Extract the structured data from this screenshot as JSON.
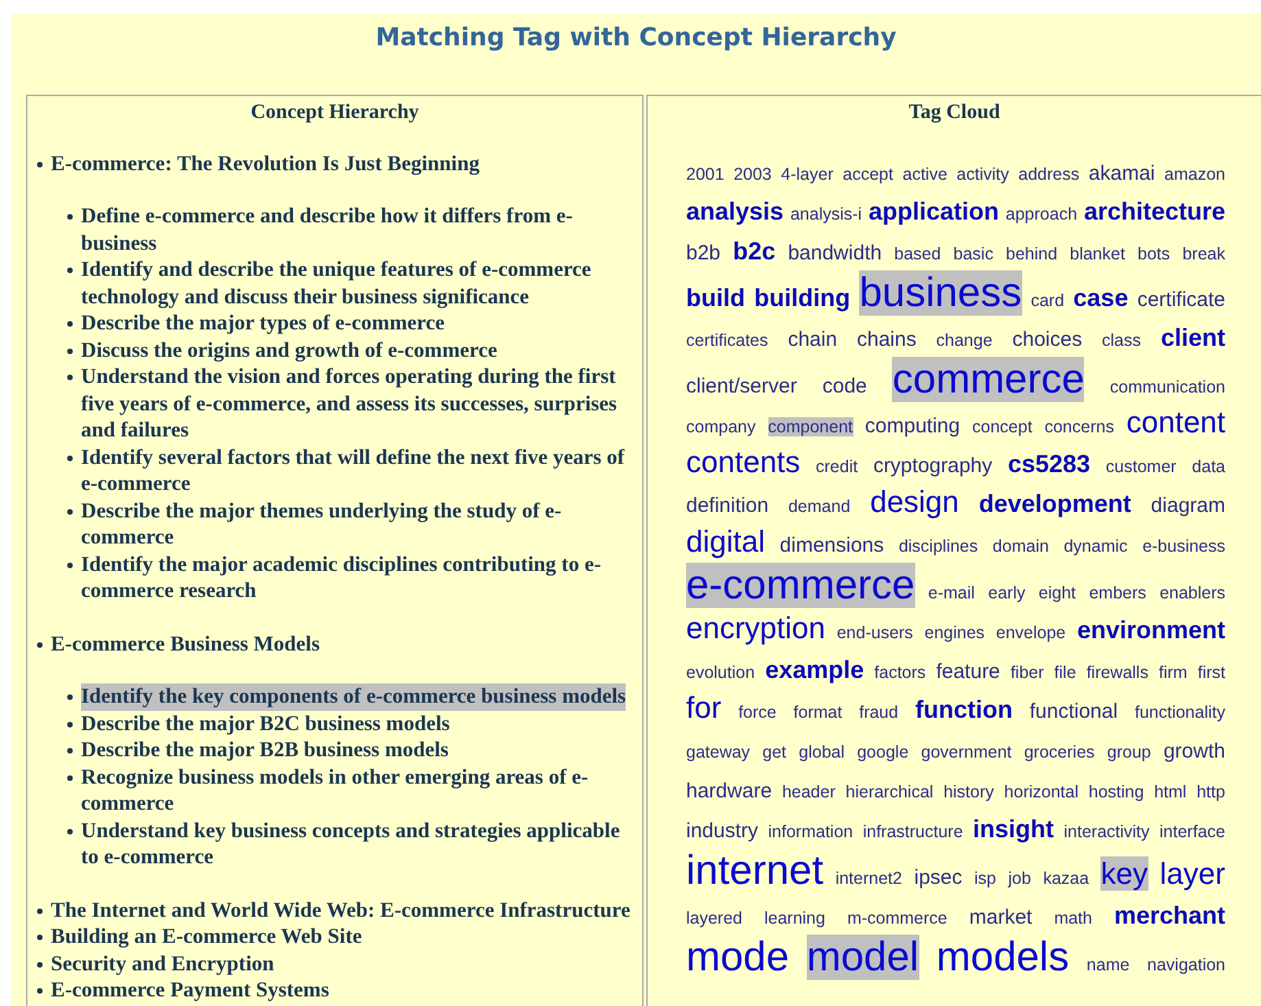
{
  "page_title": "Matching Tag with Concept Hierarchy",
  "concept_hierarchy": {
    "title": "Concept Hierarchy",
    "items": [
      {
        "label": "E-commerce: The Revolution Is Just Beginning",
        "children": [
          {
            "label": "Define e-commerce and describe how it differs from e-business",
            "highlighted": false
          },
          {
            "label": "Identify and describe the unique features of e-commerce technology and discuss their business significance",
            "highlighted": false
          },
          {
            "label": "Describe the major types of e-commerce",
            "highlighted": false
          },
          {
            "label": "Discuss the origins and growth of e-commerce",
            "highlighted": false
          },
          {
            "label": "Understand the vision and forces operating during the first five years of e-commerce, and assess its successes, surprises and failures",
            "highlighted": false
          },
          {
            "label": "Identify several factors that will define the next five years of e-commerce",
            "highlighted": false
          },
          {
            "label": "Describe the major themes underlying the study of e-commerce",
            "highlighted": false
          },
          {
            "label": "Identify the major academic disciplines contributing to e-commerce research",
            "highlighted": false
          }
        ]
      },
      {
        "label": "E-commerce Business Models",
        "children": [
          {
            "label": "Identify the key components of e-commerce business models",
            "highlighted": true
          },
          {
            "label": "Describe the major B2C business models",
            "highlighted": false
          },
          {
            "label": "Describe the major B2B business models",
            "highlighted": false
          },
          {
            "label": "Recognize business models in other emerging areas of e-commerce",
            "highlighted": false
          },
          {
            "label": "Understand key business concepts and strategies applicable to e-commerce",
            "highlighted": false
          }
        ]
      },
      {
        "label": "The Internet and World Wide Web: E-commerce Infrastructure"
      },
      {
        "label": "Building an E-commerce Web Site"
      },
      {
        "label": "Security and Encryption"
      },
      {
        "label": "E-commerce Payment Systems"
      }
    ]
  },
  "tag_cloud": {
    "title": "Tag Cloud",
    "tags": [
      {
        "label": "2001",
        "kind": "tiny",
        "highlighted": false
      },
      {
        "label": "2003",
        "kind": "tiny",
        "highlighted": false
      },
      {
        "label": "4-layer",
        "kind": "tiny",
        "highlighted": false
      },
      {
        "label": "accept",
        "kind": "tiny",
        "highlighted": false
      },
      {
        "label": "active",
        "kind": "tiny",
        "highlighted": false
      },
      {
        "label": "activity",
        "kind": "tiny",
        "highlighted": false
      },
      {
        "label": "address",
        "kind": "tiny",
        "highlighted": false
      },
      {
        "label": "akamai",
        "kind": "small",
        "highlighted": false
      },
      {
        "label": "amazon",
        "kind": "tiny",
        "highlighted": false
      },
      {
        "label": "analysis",
        "kind": "medium",
        "highlighted": false
      },
      {
        "label": "analysis-i",
        "kind": "tiny",
        "highlighted": false
      },
      {
        "label": "application",
        "kind": "medium",
        "highlighted": false
      },
      {
        "label": "approach",
        "kind": "tiny",
        "highlighted": false
      },
      {
        "label": "architecture",
        "kind": "medium",
        "highlighted": false
      },
      {
        "label": "b2b",
        "kind": "small",
        "highlighted": false
      },
      {
        "label": "b2c",
        "kind": "medium",
        "highlighted": false
      },
      {
        "label": "bandwidth",
        "kind": "small",
        "highlighted": false
      },
      {
        "label": "based",
        "kind": "tiny",
        "highlighted": false
      },
      {
        "label": "basic",
        "kind": "tiny",
        "highlighted": false
      },
      {
        "label": "behind",
        "kind": "tiny",
        "highlighted": false
      },
      {
        "label": "blanket",
        "kind": "tiny",
        "highlighted": false
      },
      {
        "label": "bots",
        "kind": "tiny",
        "highlighted": false
      },
      {
        "label": "break",
        "kind": "tiny",
        "highlighted": false
      },
      {
        "label": "build",
        "kind": "medium",
        "highlighted": false
      },
      {
        "label": "building",
        "kind": "medium",
        "highlighted": false
      },
      {
        "label": "business",
        "kind": "huge",
        "highlighted": true
      },
      {
        "label": "card",
        "kind": "tiny",
        "highlighted": false
      },
      {
        "label": "case",
        "kind": "medium",
        "highlighted": false
      },
      {
        "label": "certificate",
        "kind": "small",
        "highlighted": false
      },
      {
        "label": "certificates",
        "kind": "tiny",
        "highlighted": false
      },
      {
        "label": "chain",
        "kind": "small",
        "highlighted": false
      },
      {
        "label": "chains",
        "kind": "small",
        "highlighted": false
      },
      {
        "label": "change",
        "kind": "tiny",
        "highlighted": false
      },
      {
        "label": "choices",
        "kind": "small",
        "highlighted": false
      },
      {
        "label": "class",
        "kind": "tiny",
        "highlighted": false
      },
      {
        "label": "client",
        "kind": "medium",
        "highlighted": false
      },
      {
        "label": "client/server",
        "kind": "small",
        "highlighted": false
      },
      {
        "label": "code",
        "kind": "small",
        "highlighted": false
      },
      {
        "label": "commerce",
        "kind": "huge",
        "highlighted": true
      },
      {
        "label": "communication",
        "kind": "tiny",
        "highlighted": false
      },
      {
        "label": "company",
        "kind": "tiny",
        "highlighted": false
      },
      {
        "label": "component",
        "kind": "tiny",
        "highlighted": true
      },
      {
        "label": "computing",
        "kind": "small",
        "highlighted": false
      },
      {
        "label": "concept",
        "kind": "tiny",
        "highlighted": false
      },
      {
        "label": "concerns",
        "kind": "tiny",
        "highlighted": false
      },
      {
        "label": "content",
        "kind": "large",
        "highlighted": false
      },
      {
        "label": "contents",
        "kind": "large",
        "highlighted": false
      },
      {
        "label": "credit",
        "kind": "tiny",
        "highlighted": false
      },
      {
        "label": "cryptography",
        "kind": "small",
        "highlighted": false
      },
      {
        "label": "cs5283",
        "kind": "medium",
        "highlighted": false
      },
      {
        "label": "customer",
        "kind": "tiny",
        "highlighted": false
      },
      {
        "label": "data",
        "kind": "tiny",
        "highlighted": false
      },
      {
        "label": "definition",
        "kind": "small",
        "highlighted": false
      },
      {
        "label": "demand",
        "kind": "tiny",
        "highlighted": false
      },
      {
        "label": "design",
        "kind": "large",
        "highlighted": false
      },
      {
        "label": "development",
        "kind": "medium",
        "highlighted": false
      },
      {
        "label": "diagram",
        "kind": "small",
        "highlighted": false
      },
      {
        "label": "digital",
        "kind": "large",
        "highlighted": false
      },
      {
        "label": "dimensions",
        "kind": "small",
        "highlighted": false
      },
      {
        "label": "disciplines",
        "kind": "tiny",
        "highlighted": false
      },
      {
        "label": "domain",
        "kind": "tiny",
        "highlighted": false
      },
      {
        "label": "dynamic",
        "kind": "tiny",
        "highlighted": false
      },
      {
        "label": "e-business",
        "kind": "tiny",
        "highlighted": false
      },
      {
        "label": "e-commerce",
        "kind": "huge",
        "highlighted": true
      },
      {
        "label": "e-mail",
        "kind": "tiny",
        "highlighted": false
      },
      {
        "label": "early",
        "kind": "tiny",
        "highlighted": false
      },
      {
        "label": "eight",
        "kind": "tiny",
        "highlighted": false
      },
      {
        "label": "embers",
        "kind": "tiny",
        "highlighted": false
      },
      {
        "label": "enablers",
        "kind": "tiny",
        "highlighted": false
      },
      {
        "label": "encryption",
        "kind": "large",
        "highlighted": false
      },
      {
        "label": "end-users",
        "kind": "tiny",
        "highlighted": false
      },
      {
        "label": "engines",
        "kind": "tiny",
        "highlighted": false
      },
      {
        "label": "envelope",
        "kind": "tiny",
        "highlighted": false
      },
      {
        "label": "environment",
        "kind": "medium",
        "highlighted": false
      },
      {
        "label": "evolution",
        "kind": "tiny",
        "highlighted": false
      },
      {
        "label": "example",
        "kind": "medium",
        "highlighted": false
      },
      {
        "label": "factors",
        "kind": "tiny",
        "highlighted": false
      },
      {
        "label": "feature",
        "kind": "small",
        "highlighted": false
      },
      {
        "label": "fiber",
        "kind": "tiny",
        "highlighted": false
      },
      {
        "label": "file",
        "kind": "tiny",
        "highlighted": false
      },
      {
        "label": "firewalls",
        "kind": "tiny",
        "highlighted": false
      },
      {
        "label": "firm",
        "kind": "tiny",
        "highlighted": false
      },
      {
        "label": "first",
        "kind": "tiny",
        "highlighted": false
      },
      {
        "label": "for",
        "kind": "large",
        "highlighted": false
      },
      {
        "label": "force",
        "kind": "tiny",
        "highlighted": false
      },
      {
        "label": "format",
        "kind": "tiny",
        "highlighted": false
      },
      {
        "label": "fraud",
        "kind": "tiny",
        "highlighted": false
      },
      {
        "label": "function",
        "kind": "medium",
        "highlighted": false
      },
      {
        "label": "functional",
        "kind": "small",
        "highlighted": false
      },
      {
        "label": "functionality",
        "kind": "tiny",
        "highlighted": false
      },
      {
        "label": "gateway",
        "kind": "tiny",
        "highlighted": false
      },
      {
        "label": "get",
        "kind": "tiny",
        "highlighted": false
      },
      {
        "label": "global",
        "kind": "tiny",
        "highlighted": false
      },
      {
        "label": "google",
        "kind": "tiny",
        "highlighted": false
      },
      {
        "label": "government",
        "kind": "tiny",
        "highlighted": false
      },
      {
        "label": "groceries",
        "kind": "tiny",
        "highlighted": false
      },
      {
        "label": "group",
        "kind": "tiny",
        "highlighted": false
      },
      {
        "label": "growth",
        "kind": "small",
        "highlighted": false
      },
      {
        "label": "hardware",
        "kind": "small",
        "highlighted": false
      },
      {
        "label": "header",
        "kind": "tiny",
        "highlighted": false
      },
      {
        "label": "hierarchical",
        "kind": "tiny",
        "highlighted": false
      },
      {
        "label": "history",
        "kind": "tiny",
        "highlighted": false
      },
      {
        "label": "horizontal",
        "kind": "tiny",
        "highlighted": false
      },
      {
        "label": "hosting",
        "kind": "tiny",
        "highlighted": false
      },
      {
        "label": "html",
        "kind": "tiny",
        "highlighted": false
      },
      {
        "label": "http",
        "kind": "tiny",
        "highlighted": false
      },
      {
        "label": "industry",
        "kind": "small",
        "highlighted": false
      },
      {
        "label": "information",
        "kind": "tiny",
        "highlighted": false
      },
      {
        "label": "infrastructure",
        "kind": "tiny",
        "highlighted": false
      },
      {
        "label": "insight",
        "kind": "medium",
        "highlighted": false
      },
      {
        "label": "interactivity",
        "kind": "tiny",
        "highlighted": false
      },
      {
        "label": "interface",
        "kind": "tiny",
        "highlighted": false
      },
      {
        "label": "internet",
        "kind": "huge",
        "highlighted": false
      },
      {
        "label": "internet2",
        "kind": "tiny",
        "highlighted": false
      },
      {
        "label": "ipsec",
        "kind": "small",
        "highlighted": false
      },
      {
        "label": "isp",
        "kind": "tiny",
        "highlighted": false
      },
      {
        "label": "job",
        "kind": "tiny",
        "highlighted": false
      },
      {
        "label": "kazaa",
        "kind": "tiny",
        "highlighted": false
      },
      {
        "label": "key",
        "kind": "large",
        "highlighted": true
      },
      {
        "label": "layer",
        "kind": "large",
        "highlighted": false
      },
      {
        "label": "layered",
        "kind": "tiny",
        "highlighted": false
      },
      {
        "label": "learning",
        "kind": "tiny",
        "highlighted": false
      },
      {
        "label": "m-commerce",
        "kind": "tiny",
        "highlighted": false
      },
      {
        "label": "market",
        "kind": "small",
        "highlighted": false
      },
      {
        "label": "math",
        "kind": "tiny",
        "highlighted": false
      },
      {
        "label": "merchant",
        "kind": "medium",
        "highlighted": false
      },
      {
        "label": "mode",
        "kind": "huge",
        "highlighted": false
      },
      {
        "label": "model",
        "kind": "huge",
        "highlighted": true
      },
      {
        "label": "models",
        "kind": "huge",
        "highlighted": false
      },
      {
        "label": "name",
        "kind": "tiny",
        "highlighted": false
      },
      {
        "label": "navigation",
        "kind": "tiny",
        "highlighted": false
      }
    ]
  }
}
